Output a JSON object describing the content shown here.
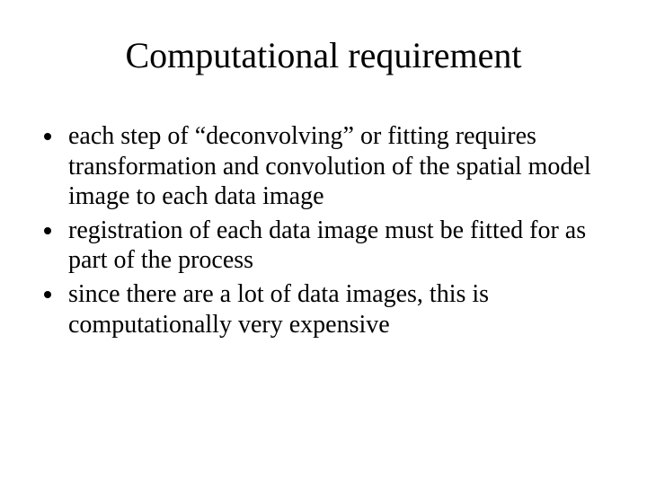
{
  "title": "Computational requirement",
  "bullets": [
    "each step of “deconvolving” or fitting requires transformation and convolution of the spatial model image to each data image",
    "registration of each data image must be fitted for as part of the process",
    "since there are a lot of data images, this is computationally very expensive"
  ]
}
